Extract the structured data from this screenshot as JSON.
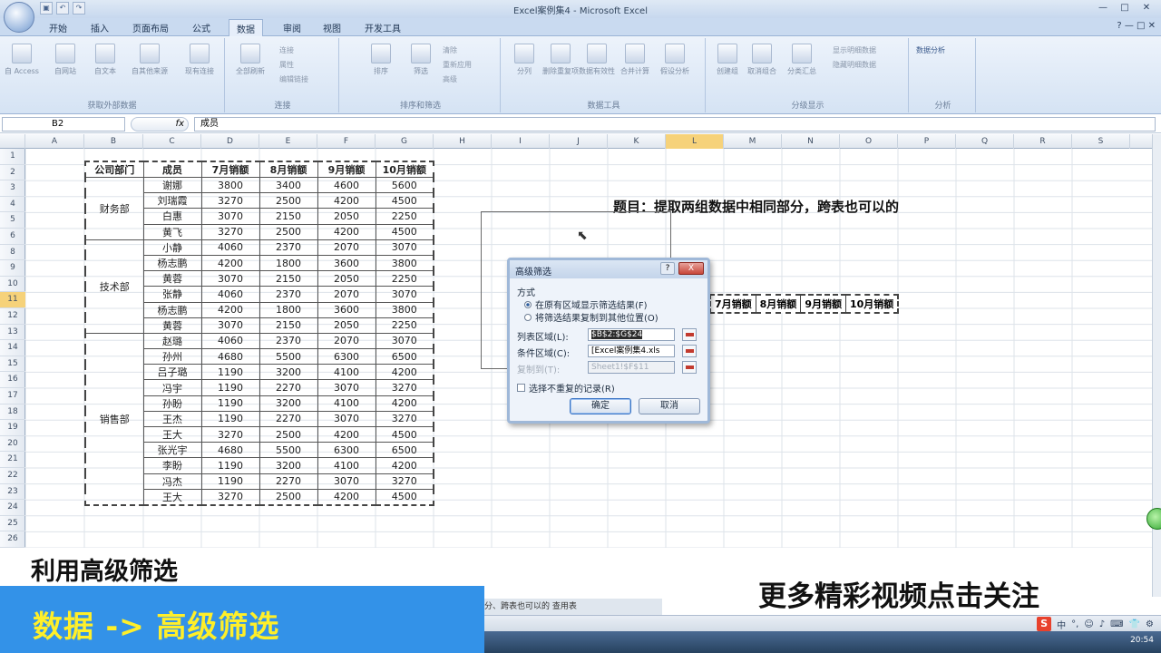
{
  "window": {
    "title": "Excel案例集4 - Microsoft Excel",
    "controls": [
      "—",
      "□",
      "✕"
    ]
  },
  "ribbon_tabs": [
    "开始",
    "插入",
    "页面布局",
    "公式",
    "数据",
    "审阅",
    "视图",
    "开发工具"
  ],
  "ribbon_groups": [
    {
      "label": "获取外部数据",
      "buttons": [
        "自 Access",
        "自网站",
        "自文本",
        "自其他来源",
        "现有连接"
      ]
    },
    {
      "label": "连接",
      "buttons": [
        "全部刷新"
      ],
      "small": [
        "连接",
        "属性",
        "编辑链接"
      ]
    },
    {
      "label": "排序和筛选",
      "buttons": [
        "排序",
        "筛选"
      ],
      "small": [
        "清除",
        "重新应用",
        "高级"
      ]
    },
    {
      "label": "数据工具",
      "buttons": [
        "分列",
        "删除重复项",
        "数据有效性",
        "合并计算",
        "假设分析"
      ]
    },
    {
      "label": "分级显示",
      "buttons": [
        "创建组",
        "取消组合",
        "分类汇总"
      ],
      "small": [
        "显示明细数据",
        "隐藏明细数据"
      ]
    },
    {
      "label": "分析",
      "buttons": [
        "数据分析"
      ]
    }
  ],
  "formula_bar": {
    "name_box": "B2",
    "fx": "fx",
    "formula": "成员"
  },
  "columns": [
    "A",
    "B",
    "C",
    "D",
    "E",
    "F",
    "G",
    "H",
    "I",
    "J",
    "K",
    "L",
    "M",
    "N",
    "O",
    "P",
    "Q",
    "R",
    "S"
  ],
  "rows": [
    "1",
    "2",
    "3",
    "4",
    "5",
    "6",
    "8",
    "9",
    "10",
    "11",
    "12",
    "13",
    "14",
    "15",
    "16",
    "17",
    "18",
    "19",
    "20",
    "21",
    "22",
    "23",
    "24",
    "25",
    "26"
  ],
  "table": {
    "headers": [
      "公司部门",
      "成员",
      "7月销额",
      "8月销额",
      "9月销额",
      "10月销额"
    ],
    "groups": [
      {
        "dept": "财务部",
        "rows": [
          [
            "谢娜",
            "3800",
            "3400",
            "4600",
            "5600"
          ],
          [
            "刘瑞霞",
            "3270",
            "2500",
            "4200",
            "4500"
          ],
          [
            "白惠",
            "3070",
            "2150",
            "2050",
            "2250"
          ],
          [
            "黄飞",
            "3270",
            "2500",
            "4200",
            "4500"
          ]
        ]
      },
      {
        "dept": "技术部",
        "rows": [
          [
            "小静",
            "4060",
            "2370",
            "2070",
            "3070"
          ],
          [
            "杨志鹏",
            "4200",
            "1800",
            "3600",
            "3800"
          ],
          [
            "黄蓉",
            "3070",
            "2150",
            "2050",
            "2250"
          ],
          [
            "张静",
            "4060",
            "2370",
            "2070",
            "3070"
          ],
          [
            "杨志鹏",
            "4200",
            "1800",
            "3600",
            "3800"
          ],
          [
            "黄蓉",
            "3070",
            "2150",
            "2050",
            "2250"
          ]
        ]
      },
      {
        "dept": "销售部",
        "rows": [
          [
            "赵璐",
            "4060",
            "2370",
            "2070",
            "3070"
          ],
          [
            "孙州",
            "4680",
            "5500",
            "6300",
            "6500"
          ],
          [
            "吕子璐",
            "1190",
            "3200",
            "4100",
            "4200"
          ],
          [
            "冯宇",
            "1190",
            "2270",
            "3070",
            "3270"
          ],
          [
            "孙盼",
            "1190",
            "3200",
            "4100",
            "4200"
          ],
          [
            "王杰",
            "1190",
            "2270",
            "3070",
            "3270"
          ],
          [
            "王大",
            "3270",
            "2500",
            "4200",
            "4500"
          ],
          [
            "张光宇",
            "4680",
            "5500",
            "6300",
            "6500"
          ],
          [
            "李盼",
            "1190",
            "3200",
            "4100",
            "4200"
          ],
          [
            "冯杰",
            "1190",
            "2270",
            "3070",
            "3270"
          ],
          [
            "王大",
            "3270",
            "2500",
            "4200",
            "4500"
          ]
        ]
      }
    ]
  },
  "question": "题目：提取两组数据中相同部分，跨表也可以的",
  "criteria_headers": [
    "7月销额",
    "8月销额",
    "9月销额",
    "10月销额"
  ],
  "dialog": {
    "title": "高级筛选",
    "help": "?",
    "close": "X",
    "mode_label": "方式",
    "option1": "在原有区域显示筛选结果(F)",
    "option2": "将筛选结果复制到其他位置(O)",
    "list_label": "列表区域(L):",
    "list_value": "$B$2:$G$24",
    "criteria_label": "条件区域(C):",
    "criteria_value": "[Excel案例集4.xls",
    "copy_label": "复制到(T):",
    "copy_value": "Sheet1!$F$11",
    "unique_label": "选择不重复的记录(R)",
    "ok": "确定",
    "cancel": "取消"
  },
  "sheet_tabs": "分、跨表也可以的  查用表",
  "captions": {
    "top_left": "利用高级筛选",
    "blue_bar": "数据 -> 高级筛选",
    "bottom_right": "更多精彩视频点击关注"
  },
  "tray": {
    "sogou": "S",
    "ime": "中",
    "clock": "20:54"
  },
  "colors": {
    "caption_bar": "#3392e8",
    "caption_bar_text": "#ffef29",
    "selected_header": "#f6d27a"
  }
}
